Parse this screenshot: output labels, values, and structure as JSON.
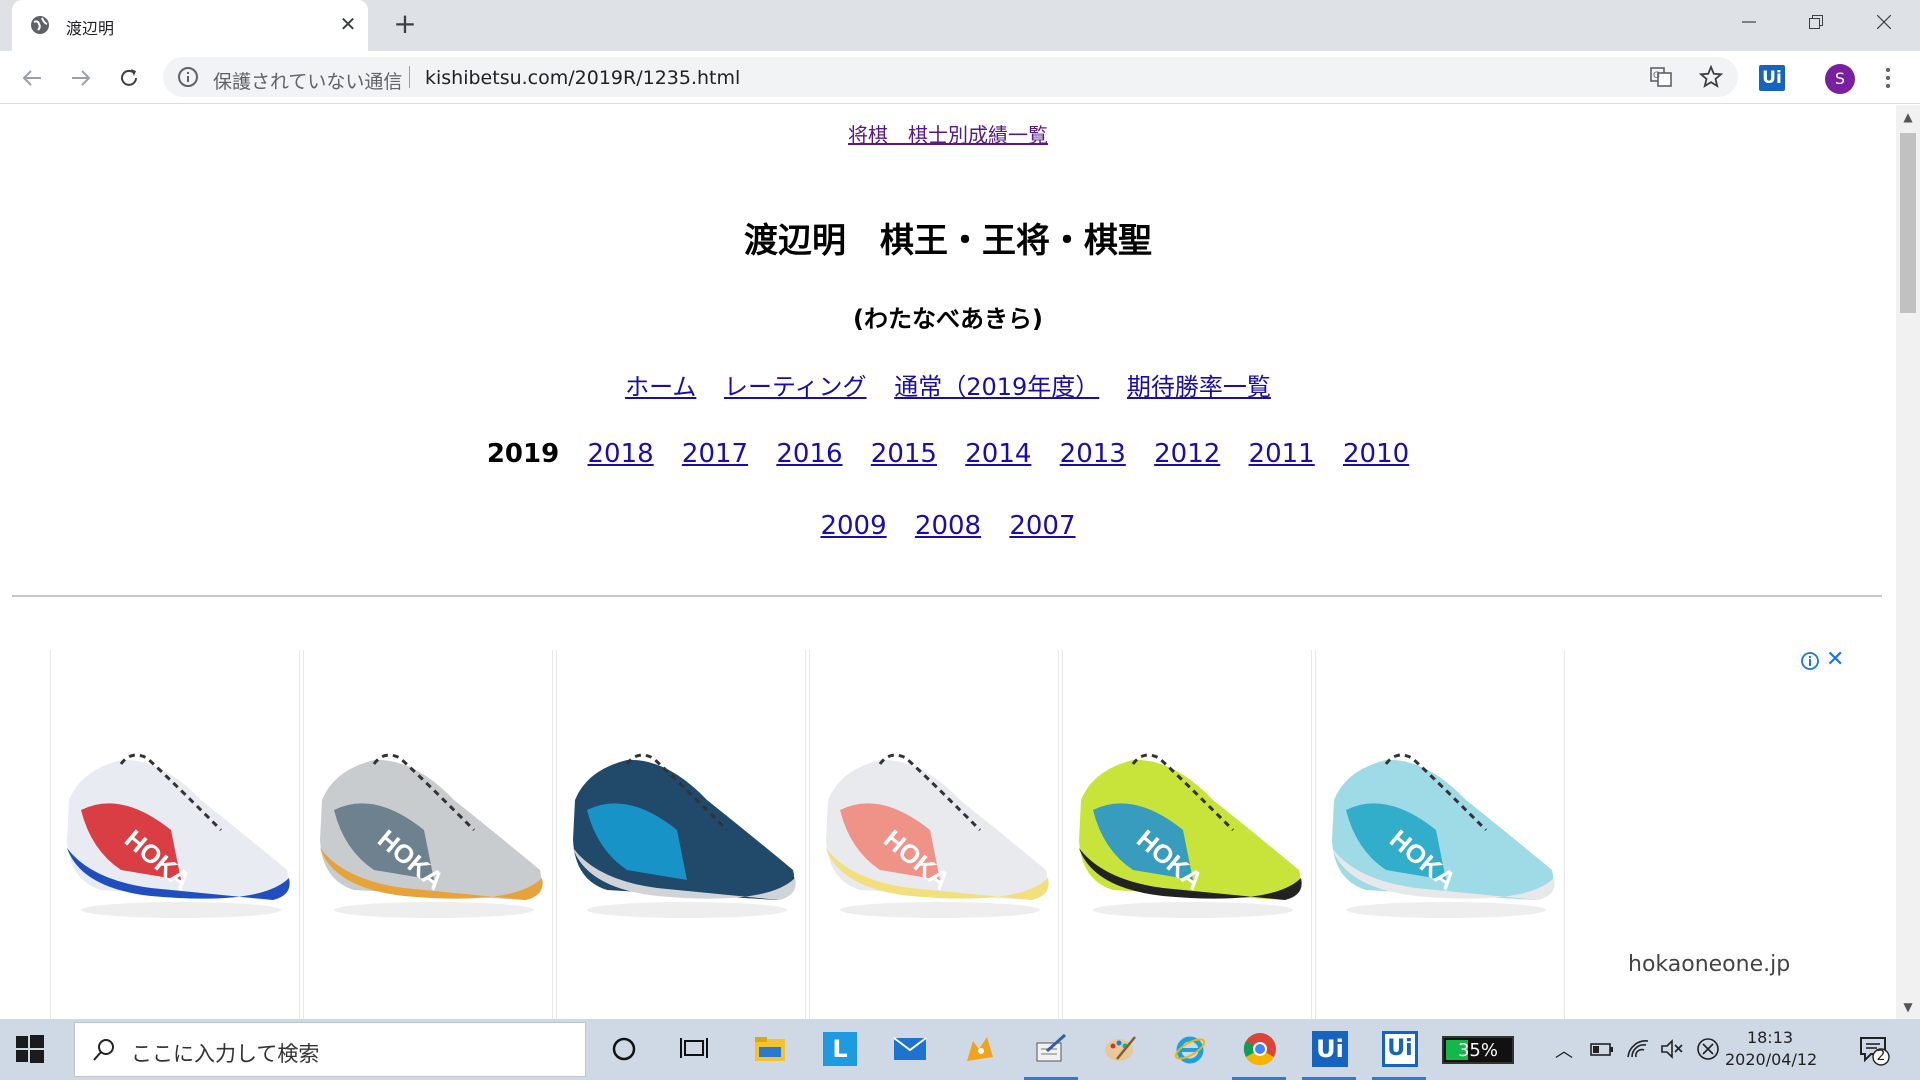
{
  "browser": {
    "tab_title": "渡辺明",
    "security_text": "保護されていない通信",
    "url": "kishibetsu.com/2019R/1235.html",
    "profile_initial": "S",
    "extension_label": "Ui"
  },
  "page": {
    "top_link": "将棋　棋士別成績一覧",
    "title": "渡辺明　棋王・王将・棋聖",
    "reading": "(わたなべあきら)",
    "nav_links": [
      "ホーム",
      "レーティング",
      "通常（2019年度）",
      "期待勝率一覧"
    ],
    "current_year": "2019",
    "years_row1": [
      "2018",
      "2017",
      "2016",
      "2015",
      "2014",
      "2013",
      "2012",
      "2011",
      "2010"
    ],
    "years_row2": [
      "2009",
      "2008",
      "2007"
    ]
  },
  "ad": {
    "domain": "hokaoneone.jp",
    "shoes": [
      {
        "colors": [
          "#e8ecf2",
          "#d72027",
          "#1f4fbf"
        ],
        "brand": "HOKA"
      },
      {
        "colors": [
          "#c9ccce",
          "#5d7482",
          "#e7a23a"
        ],
        "brand": "HOKA"
      },
      {
        "colors": [
          "#20496a",
          "#17a0d8",
          "#d0d4d8"
        ],
        "brand": ""
      },
      {
        "colors": [
          "#e8eaee",
          "#f08276",
          "#f3df7c"
        ],
        "brand": "HOKA"
      },
      {
        "colors": [
          "#c8e43a",
          "#1e8fd6",
          "#222222"
        ],
        "brand": "HOKA"
      },
      {
        "colors": [
          "#9fdbe6",
          "#1ea4c4",
          "#e6e8ea"
        ],
        "brand": "HOKA"
      }
    ]
  },
  "taskbar": {
    "search_placeholder": "ここに入力して検索",
    "battery_percent": "35%",
    "battery_level": 0.35,
    "time": "18:13",
    "date": "2020/04/12",
    "notification_count": "2",
    "pinned_letters": {
      "launcher": "L",
      "uipath1": "Ui",
      "uipath2": "Ui"
    }
  }
}
